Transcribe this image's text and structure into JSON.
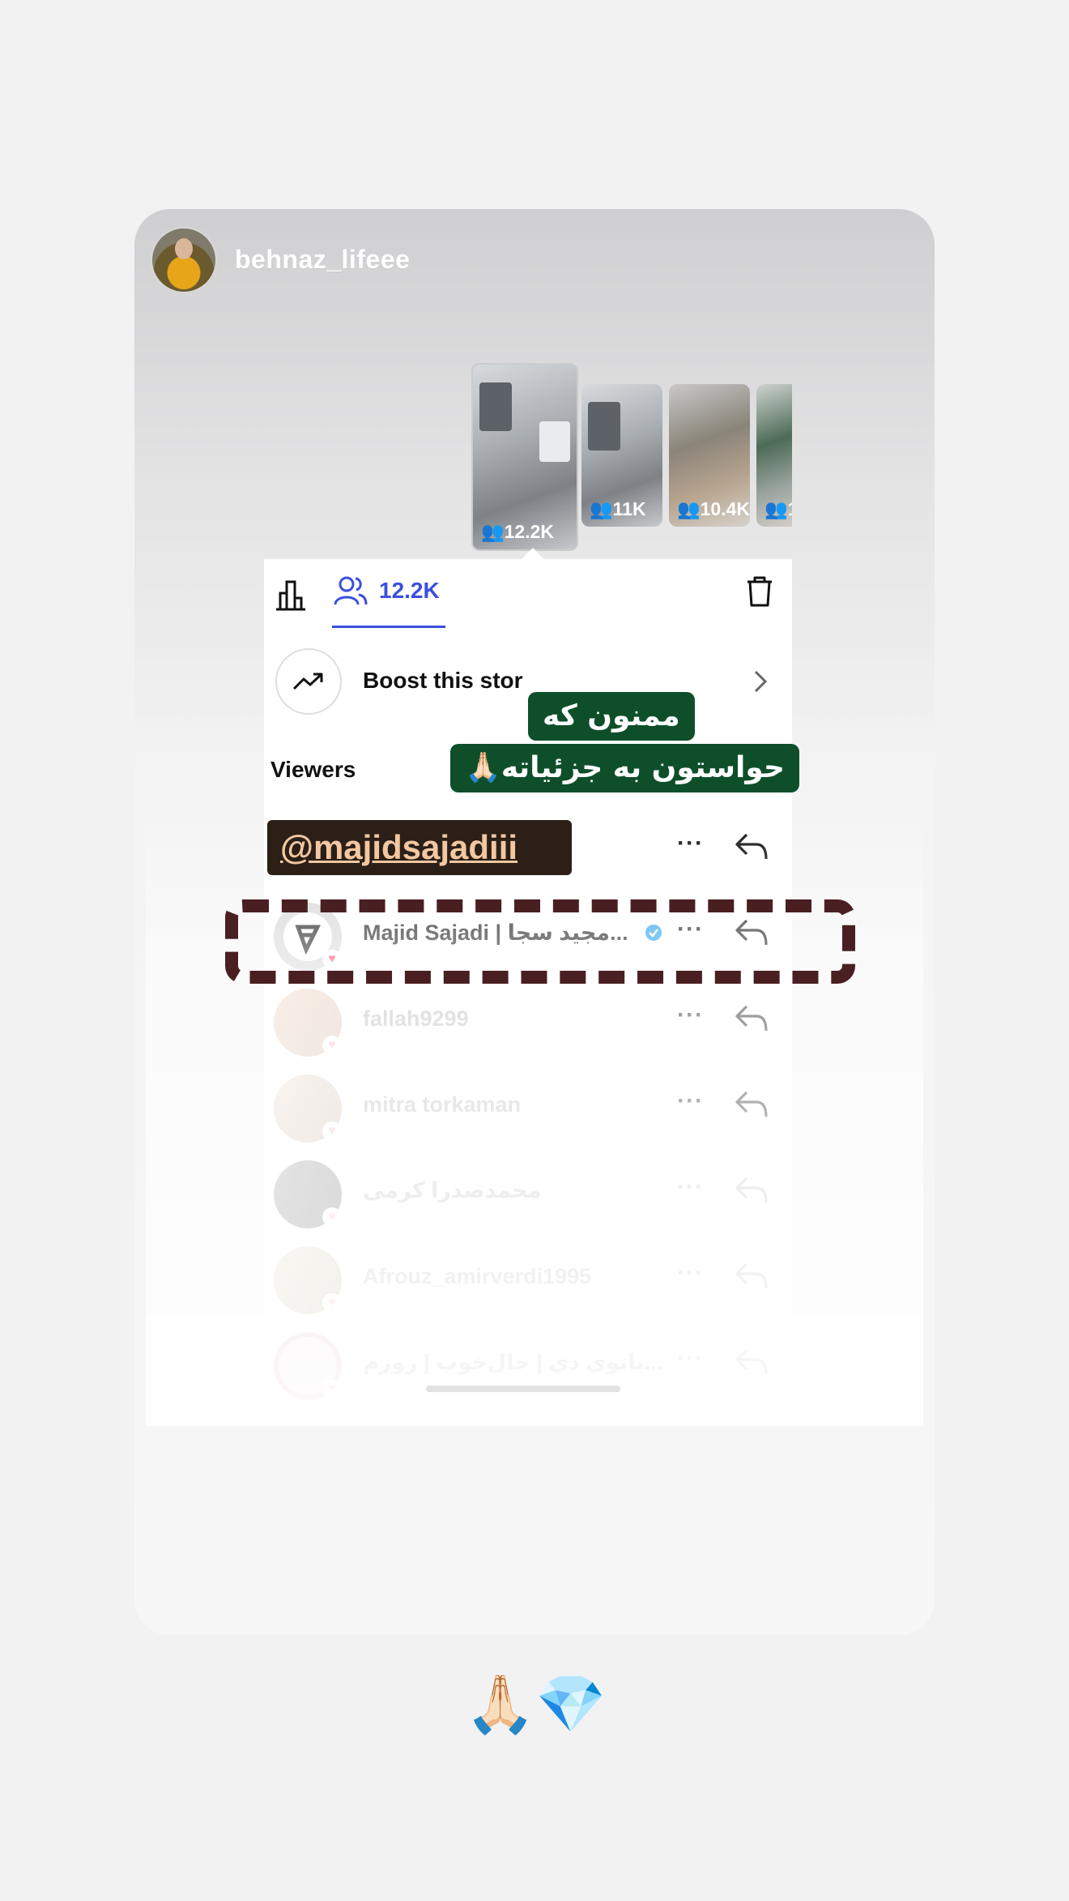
{
  "story": {
    "owner_username": "behnaz_lifeee",
    "bottom_emojis": "🙏🏻💎"
  },
  "thumbnails": [
    {
      "count": "12.2K"
    },
    {
      "count": "11K"
    },
    {
      "count": "10.4K"
    },
    {
      "count": "1"
    }
  ],
  "toolbar": {
    "viewers_count": "12.2K"
  },
  "boost": {
    "label": "Boost this stor"
  },
  "viewers": {
    "heading": "Viewers",
    "rows": [
      {
        "username": "Majid Sajadi | مجید سجا...",
        "verified": true
      },
      {
        "username": "fallah9299"
      },
      {
        "username": "mitra torkaman"
      },
      {
        "username": "محمدصدرا کرمی"
      },
      {
        "username": "Afrouz_amirverdi1995"
      },
      {
        "username": "بانوی دی | حال‌خوب | روزم..."
      }
    ],
    "more_label": "···"
  },
  "stickers": {
    "line1": "ممنون که",
    "line2": "حواستون به جزئیاته🙏🏻",
    "mention": "@majidsajadiii"
  },
  "colors": {
    "accent": "#3a4fdd",
    "sticker_green": "#0e4f2a",
    "mention_bg": "#2b1f17",
    "mention_text": "#f2c7a1",
    "dashed_border": "#4a1f22",
    "verified_blue": "#1d9bf0"
  }
}
